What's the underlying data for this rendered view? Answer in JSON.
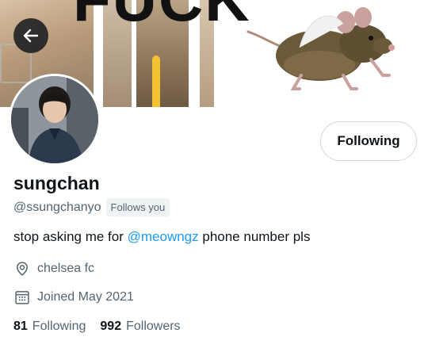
{
  "profile": {
    "display_name": "sungchan",
    "handle": "@ssungchanyo",
    "follows_you": "Follows you",
    "bio_prefix": "stop asking me for ",
    "bio_mention": "@meowngz",
    "bio_suffix": " phone number pls",
    "location": "chelsea fc",
    "joined": "Joined May 2021",
    "following_count": "81",
    "following_label": "Following",
    "followers_count": "992",
    "followers_label": "Followers"
  },
  "actions": {
    "follow_button_label": "Following"
  },
  "banner": {
    "meme_text": "FUCK"
  },
  "icons": {
    "back": "arrow-left-icon",
    "location": "location-pin-icon",
    "calendar": "calendar-icon"
  },
  "colors": {
    "link": "#1d9bf0",
    "secondary_text": "#536471",
    "primary_text": "#0f1419",
    "badge_bg": "#eff3f4"
  }
}
